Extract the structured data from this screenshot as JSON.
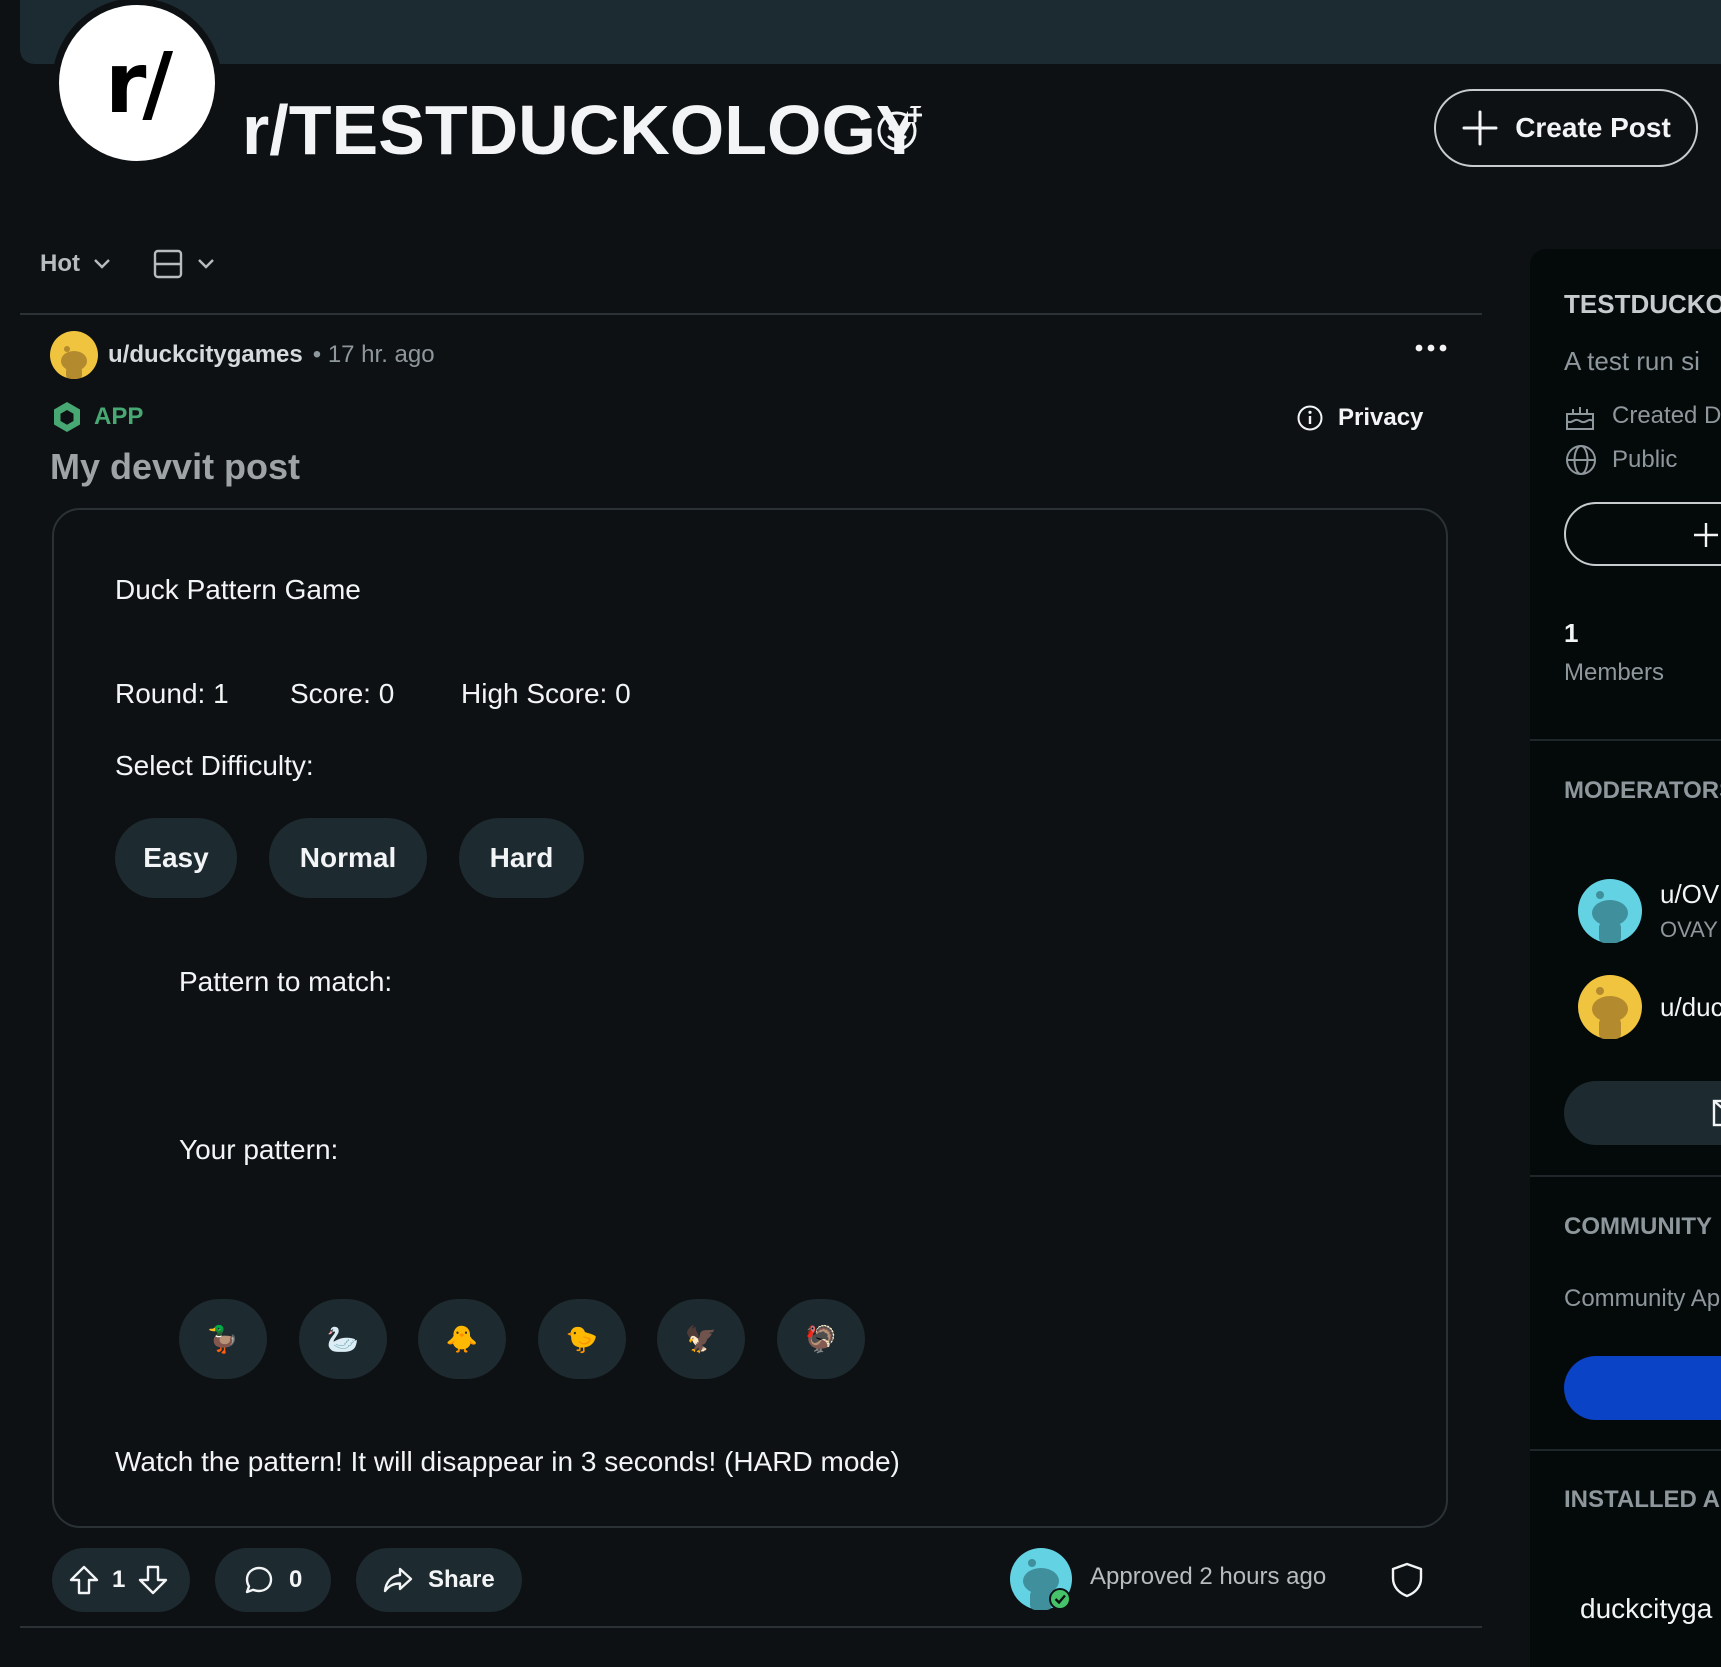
{
  "header": {
    "logo_text": "r/",
    "subreddit_name": "r/TESTDUCKOLOGY",
    "create_post_label": "Create Post"
  },
  "sort": {
    "hot_label": "Hot"
  },
  "post": {
    "author": "u/duckcitygames",
    "time": "• 17 hr. ago",
    "app_tag": "APP",
    "privacy_label": "Privacy",
    "title": "My devvit post",
    "game": {
      "title": "Duck Pattern Game",
      "round": "Round: 1",
      "score": "Score: 0",
      "high_score": "High Score: 0",
      "select_label": "Select Difficulty:",
      "difficulties": [
        "Easy",
        "Normal",
        "Hard"
      ],
      "pattern_label": "Pattern to match:",
      "your_pattern_label": "Your pattern:",
      "birds": [
        "🦆",
        "🦢",
        "🐥",
        "🐤",
        "🦅",
        "🦃"
      ],
      "message": "Watch the pattern! It will disappear in 3 seconds! (HARD mode)"
    },
    "actions": {
      "votes": "1",
      "comments": "0",
      "share_label": "Share"
    },
    "approved_text": "Approved 2 hours ago"
  },
  "sidebar": {
    "name": "TESTDUCKOLOGY",
    "description": "A test run si",
    "created": "Created D",
    "visibility": "Public",
    "members_count": "1",
    "members_label": "Members",
    "moderators_heading": "MODERATORS",
    "mod1_name": "u/OV",
    "mod1_flair": "OVAY",
    "mod2_name": "u/duc",
    "community_heading": "COMMUNITY",
    "community_apps": "Community Ap",
    "installed_heading": "INSTALLED A",
    "installed_app": "duckcityga"
  },
  "colors": {
    "background": "#0e1113",
    "banner": "#1c2a31",
    "pill": "#1d2a30",
    "app_green": "#48a873",
    "join_blue": "#0a43c5",
    "avatar_yellow": "#f0c43f",
    "avatar_teal": "#63d2e3"
  }
}
